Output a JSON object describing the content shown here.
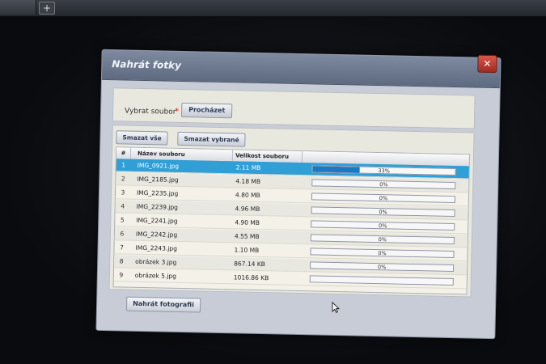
{
  "browser": {
    "new_tab_label": "+"
  },
  "dialog": {
    "title": "Nahrát fotky",
    "close_label": "✕",
    "select_file_label": "Vybrat soubor",
    "required_mark": "*",
    "browse_label": "Procházet",
    "delete_all_label": "Smazat vše",
    "delete_selected_label": "Smazat vybrané",
    "upload_label": "Nahrát fotografii"
  },
  "table": {
    "headers": {
      "num": "#",
      "name": "Název souboru",
      "size": "Velikost souboru"
    },
    "rows": [
      {
        "num": "1",
        "name": "IMG_0921.jpg",
        "size": "2.11 MB",
        "progress": 33,
        "progress_label": "33%"
      },
      {
        "num": "2",
        "name": "IMG_2185.jpg",
        "size": "4.18 MB",
        "progress": 0,
        "progress_label": "0%"
      },
      {
        "num": "3",
        "name": "IMG_2235.jpg",
        "size": "4.80 MB",
        "progress": 0,
        "progress_label": "0%"
      },
      {
        "num": "4",
        "name": "IMG_2239.jpg",
        "size": "4.96 MB",
        "progress": 0,
        "progress_label": "0%"
      },
      {
        "num": "5",
        "name": "IMG_2241.jpg",
        "size": "4.90 MB",
        "progress": 0,
        "progress_label": "0%"
      },
      {
        "num": "6",
        "name": "IMG_2242.jpg",
        "size": "4.55 MB",
        "progress": 0,
        "progress_label": "0%"
      },
      {
        "num": "7",
        "name": "IMG_2243.jpg",
        "size": "1.10 MB",
        "progress": 0,
        "progress_label": "0%"
      },
      {
        "num": "8",
        "name": "obrázek 3.jpg",
        "size": "867.14 KB",
        "progress": 0,
        "progress_label": "0%"
      },
      {
        "num": "9",
        "name": "obrázek 5.jpg",
        "size": "1016.86 KB",
        "progress": 0,
        "progress_label": ""
      }
    ],
    "selected_row": "1"
  },
  "colors": {
    "selection": "#2f9fd6",
    "progress_fill": "#1b78c4",
    "titlebar": "#6a768c",
    "close_button": "#c0392b"
  }
}
